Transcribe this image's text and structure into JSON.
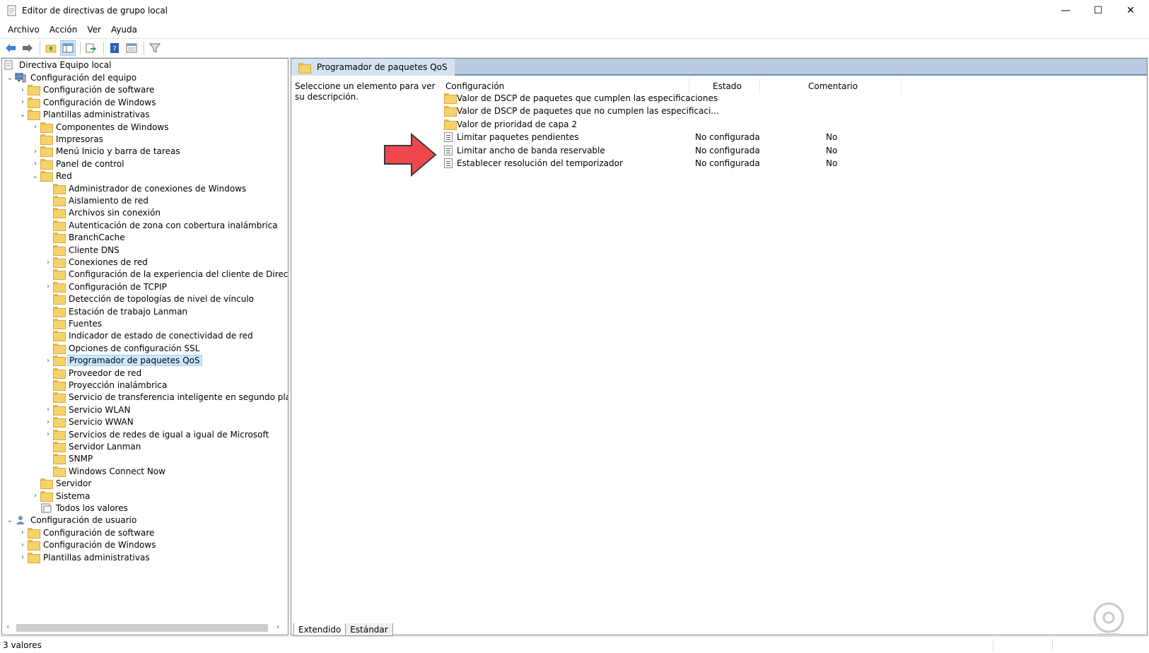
{
  "window": {
    "title": "Editor de directivas de grupo local",
    "controls": {
      "minimize": "—",
      "maximize": "☐",
      "close": "✕"
    }
  },
  "menu": [
    "Archivo",
    "Acción",
    "Ver",
    "Ayuda"
  ],
  "toolbar": [
    "back-icon",
    "forward-icon",
    "up-folder-icon",
    "show-hide-tree-icon",
    "export-list-icon",
    "help-icon",
    "properties-icon",
    "filter-icon"
  ],
  "tree": {
    "root": "Directiva Equipo local",
    "items": [
      {
        "label": "Configuración del equipo",
        "indent": 1,
        "chev": "v",
        "icon": "computer"
      },
      {
        "label": "Configuración de software",
        "indent": 2,
        "chev": ">",
        "icon": "folder"
      },
      {
        "label": "Configuración de Windows",
        "indent": 2,
        "chev": ">",
        "icon": "folder"
      },
      {
        "label": "Plantillas administrativas",
        "indent": 2,
        "chev": "v",
        "icon": "folder"
      },
      {
        "label": "Componentes de Windows",
        "indent": 3,
        "chev": ">",
        "icon": "folder"
      },
      {
        "label": "Impresoras",
        "indent": 3,
        "chev": "",
        "icon": "folder"
      },
      {
        "label": "Menú Inicio y barra de tareas",
        "indent": 3,
        "chev": ">",
        "icon": "folder"
      },
      {
        "label": "Panel de control",
        "indent": 3,
        "chev": ">",
        "icon": "folder"
      },
      {
        "label": "Red",
        "indent": 3,
        "chev": "v",
        "icon": "folder"
      },
      {
        "label": "Administrador de conexiones de Windows",
        "indent": 4,
        "chev": "",
        "icon": "folder"
      },
      {
        "label": "Aislamiento de red",
        "indent": 4,
        "chev": "",
        "icon": "folder"
      },
      {
        "label": "Archivos sin conexión",
        "indent": 4,
        "chev": "",
        "icon": "folder"
      },
      {
        "label": "Autenticación de zona con cobertura inalámbrica",
        "indent": 4,
        "chev": "",
        "icon": "folder"
      },
      {
        "label": "BranchCache",
        "indent": 4,
        "chev": "",
        "icon": "folder"
      },
      {
        "label": "Cliente DNS",
        "indent": 4,
        "chev": "",
        "icon": "folder"
      },
      {
        "label": "Conexiones de red",
        "indent": 4,
        "chev": ">",
        "icon": "folder"
      },
      {
        "label": "Configuración de la experiencia del cliente de DirectAcces",
        "indent": 4,
        "chev": "",
        "icon": "folder"
      },
      {
        "label": "Configuración de TCPIP",
        "indent": 4,
        "chev": ">",
        "icon": "folder"
      },
      {
        "label": "Detección de topologías de nivel de vínculo",
        "indent": 4,
        "chev": "",
        "icon": "folder"
      },
      {
        "label": "Estación de trabajo Lanman",
        "indent": 4,
        "chev": "",
        "icon": "folder"
      },
      {
        "label": "Fuentes",
        "indent": 4,
        "chev": "",
        "icon": "folder"
      },
      {
        "label": "Indicador de estado de conectividad de red",
        "indent": 4,
        "chev": "",
        "icon": "folder"
      },
      {
        "label": "Opciones de configuración SSL",
        "indent": 4,
        "chev": "",
        "icon": "folder"
      },
      {
        "label": "Programador de paquetes QoS",
        "indent": 4,
        "chev": ">",
        "icon": "folder",
        "selected": true
      },
      {
        "label": "Proveedor de red",
        "indent": 4,
        "chev": "",
        "icon": "folder"
      },
      {
        "label": "Proyección inalámbrica",
        "indent": 4,
        "chev": "",
        "icon": "folder"
      },
      {
        "label": "Servicio de transferencia inteligente en segundo plano (BI",
        "indent": 4,
        "chev": "",
        "icon": "folder"
      },
      {
        "label": "Servicio WLAN",
        "indent": 4,
        "chev": ">",
        "icon": "folder"
      },
      {
        "label": "Servicio WWAN",
        "indent": 4,
        "chev": ">",
        "icon": "folder"
      },
      {
        "label": "Servicios de redes de igual a igual de Microsoft",
        "indent": 4,
        "chev": ">",
        "icon": "folder"
      },
      {
        "label": "Servidor Lanman",
        "indent": 4,
        "chev": "",
        "icon": "folder"
      },
      {
        "label": "SNMP",
        "indent": 4,
        "chev": "",
        "icon": "folder"
      },
      {
        "label": "Windows Connect Now",
        "indent": 4,
        "chev": "",
        "icon": "folder"
      },
      {
        "label": "Servidor",
        "indent": 3,
        "chev": "",
        "icon": "folder"
      },
      {
        "label": "Sistema",
        "indent": 3,
        "chev": ">",
        "icon": "folder"
      },
      {
        "label": "Todos los valores",
        "indent": 3,
        "chev": "",
        "icon": "all-settings"
      },
      {
        "label": "Configuración de usuario",
        "indent": 1,
        "chev": "v",
        "icon": "user"
      },
      {
        "label": "Configuración de software",
        "indent": 2,
        "chev": ">",
        "icon": "folder"
      },
      {
        "label": "Configuración de Windows",
        "indent": 2,
        "chev": ">",
        "icon": "folder"
      },
      {
        "label": "Plantillas administrativas",
        "indent": 2,
        "chev": ">",
        "icon": "folder"
      }
    ]
  },
  "right": {
    "header": "Programador de paquetes QoS",
    "description": "Seleccione un elemento para ver su descripción.",
    "columns": {
      "setting": "Configuración",
      "state": "Estado",
      "comment": "Comentario"
    },
    "rows": [
      {
        "name": "Valor de DSCP de paquetes que cumplen las especificaciones",
        "type": "folder",
        "state": "",
        "comment": ""
      },
      {
        "name": "Valor de DSCP de paquetes que no cumplen las especificaci...",
        "type": "folder",
        "state": "",
        "comment": ""
      },
      {
        "name": "Valor de prioridad de capa 2",
        "type": "folder",
        "state": "",
        "comment": ""
      },
      {
        "name": "Limitar paquetes pendientes",
        "type": "setting",
        "state": "No configurada",
        "comment": "No"
      },
      {
        "name": "Limitar ancho de banda reservable",
        "type": "setting",
        "state": "No configurada",
        "comment": "No"
      },
      {
        "name": "Establecer resolución del temporizador",
        "type": "setting",
        "state": "No configurada",
        "comment": "No"
      }
    ]
  },
  "tabs": [
    "Extendido",
    "Estándar"
  ],
  "status": "3 valores",
  "colors": {
    "arrow": "#f0474e",
    "selection": "#cce8ff",
    "header_band": "#b9cbe0"
  }
}
